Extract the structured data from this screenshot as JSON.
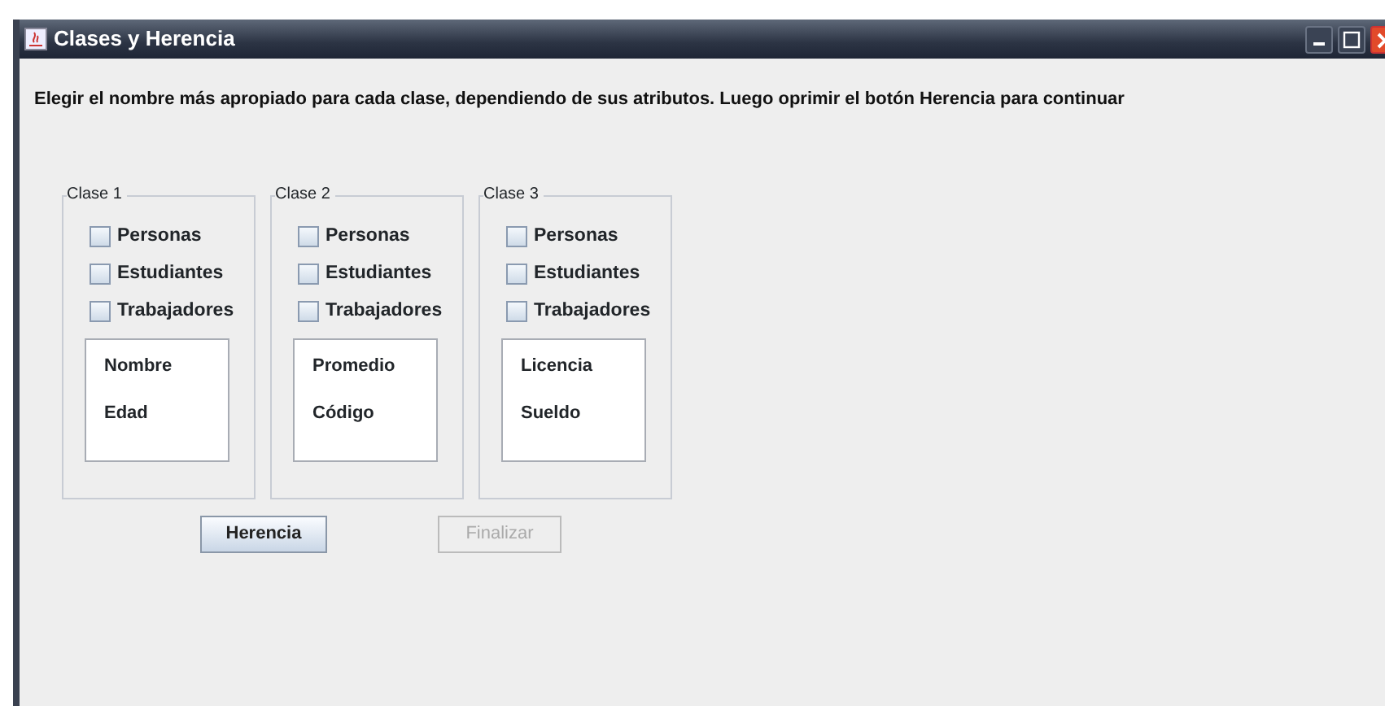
{
  "window": {
    "title": "Clases y Herencia"
  },
  "instruction": "Elegir el nombre más apropiado para cada clase, dependiendo de sus atributos. Luego oprimir el botón Herencia para continuar",
  "classes": [
    {
      "title": "Clase 1",
      "options": [
        {
          "label": "Personas",
          "checked": false
        },
        {
          "label": "Estudiantes",
          "checked": false
        },
        {
          "label": "Trabajadores",
          "checked": false
        }
      ],
      "attributes": [
        "Nombre",
        "Edad"
      ]
    },
    {
      "title": "Clase 2",
      "options": [
        {
          "label": "Personas",
          "checked": false
        },
        {
          "label": "Estudiantes",
          "checked": false
        },
        {
          "label": "Trabajadores",
          "checked": false
        }
      ],
      "attributes": [
        "Promedio",
        "Código"
      ]
    },
    {
      "title": "Clase 3",
      "options": [
        {
          "label": "Personas",
          "checked": false
        },
        {
          "label": "Estudiantes",
          "checked": false
        },
        {
          "label": "Trabajadores",
          "checked": false
        }
      ],
      "attributes": [
        "Licencia",
        "Sueldo"
      ]
    }
  ],
  "buttons": [
    {
      "label": "Herencia",
      "disabled": false
    },
    {
      "label": "Finalizar",
      "disabled": true
    }
  ]
}
